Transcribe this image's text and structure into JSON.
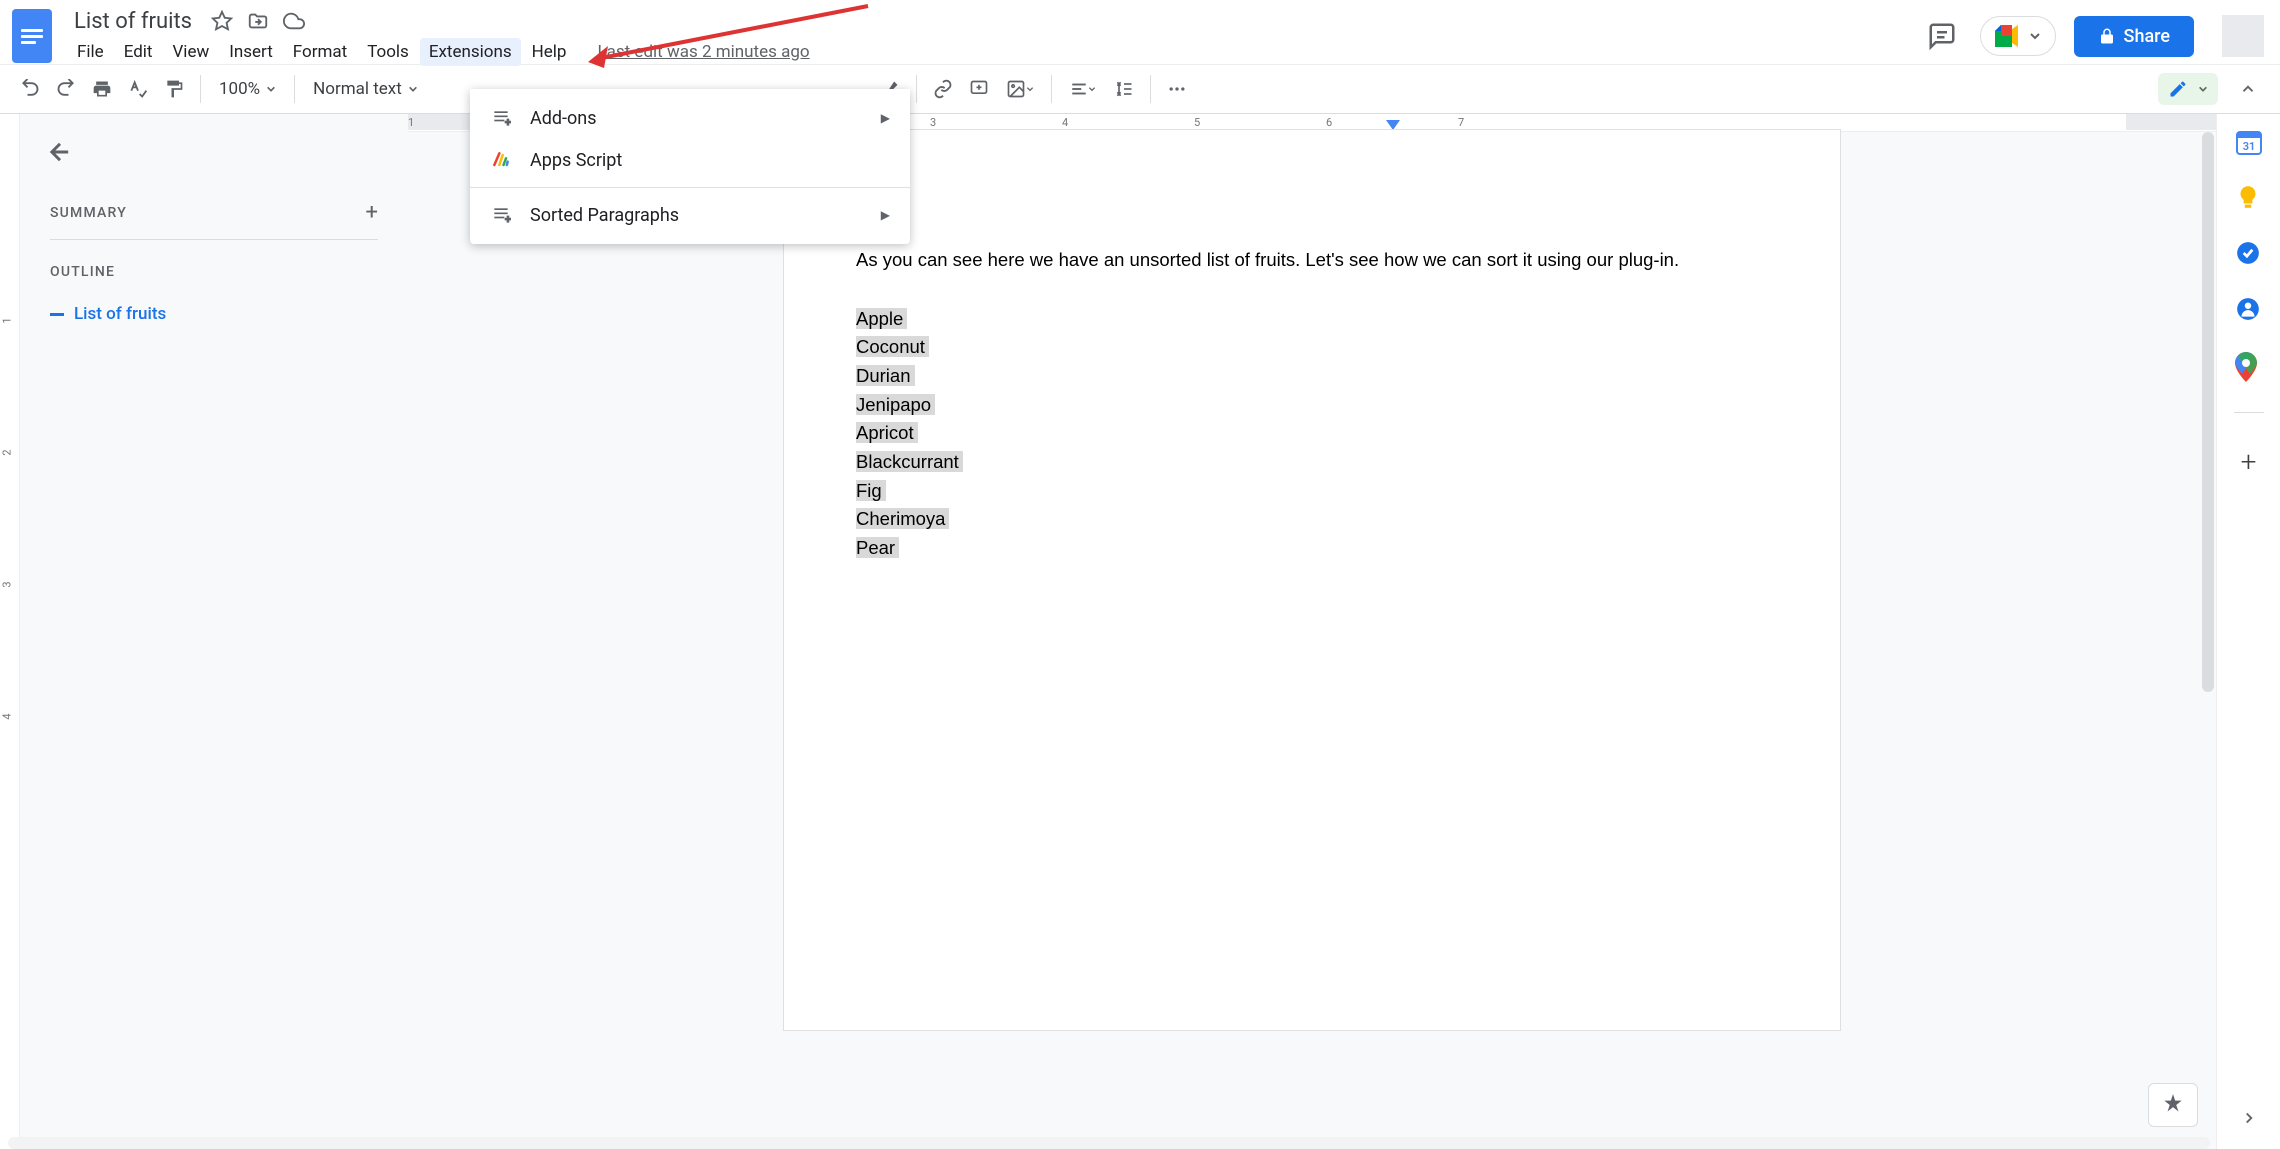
{
  "doc_title": "List of fruits",
  "menubar": {
    "file": "File",
    "edit": "Edit",
    "view": "View",
    "insert": "Insert",
    "format": "Format",
    "tools": "Tools",
    "extensions": "Extensions",
    "help": "Help",
    "last_edit": "Last edit was 2 minutes ago"
  },
  "share_label": "Share",
  "toolbar": {
    "zoom": "100%",
    "style": "Normal text"
  },
  "dropdown": {
    "addons": "Add-ons",
    "apps_script": "Apps Script",
    "sorted_paragraphs": "Sorted Paragraphs"
  },
  "outline": {
    "summary_label": "SUMMARY",
    "outline_label": "OUTLINE",
    "item1": "List of fruits"
  },
  "doc": {
    "body": "As you can see here we have an unsorted list of fruits. Let's see how we can sort it using our plug-in.",
    "fruits": [
      "Apple",
      "Coconut",
      "Durian",
      "Jenipapo",
      "Apricot",
      "Blackcurrant",
      "Fig",
      "Cherimoya",
      "Pear"
    ]
  },
  "ruler": {
    "h": [
      "1",
      "3",
      "4",
      "5",
      "6",
      "7"
    ],
    "v": [
      "1",
      "2",
      "3",
      "4"
    ]
  },
  "calendar_day": "31"
}
